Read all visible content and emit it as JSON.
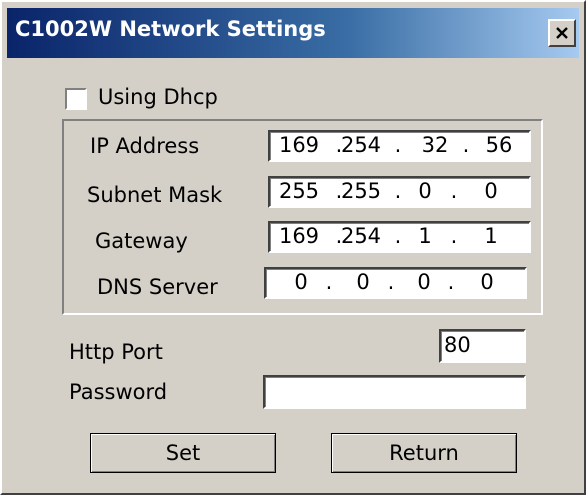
{
  "window": {
    "title": "C1002W Network Settings",
    "close_icon": "close-icon"
  },
  "dhcp": {
    "label": "Using Dhcp",
    "checked": false
  },
  "network": {
    "ip_address": {
      "label": "IP Address",
      "octets": [
        "169",
        "254",
        "32",
        "56"
      ]
    },
    "subnet_mask": {
      "label": "Subnet Mask",
      "octets": [
        "255",
        "255",
        "0",
        "0"
      ]
    },
    "gateway": {
      "label": "Gateway",
      "octets": [
        "169",
        "254",
        "1",
        "1"
      ]
    },
    "dns_server": {
      "label": "DNS Server",
      "octets": [
        "0",
        "0",
        "0",
        "0"
      ]
    },
    "separator": "."
  },
  "http_port": {
    "label": "Http Port",
    "value": "80"
  },
  "password": {
    "label": "Password",
    "value": ""
  },
  "buttons": {
    "set": "Set",
    "return": "Return"
  }
}
